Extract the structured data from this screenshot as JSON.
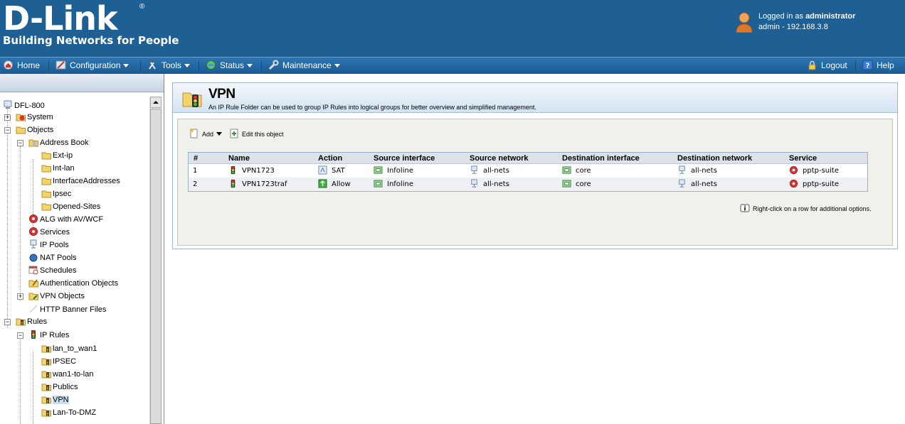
{
  "header": {
    "brand": "D-Link",
    "reg": "®",
    "tagline": "Building Networks for People",
    "logged_in_prefix": "Logged in as",
    "username": "administrator",
    "session": "admin - 192.168.3.8"
  },
  "menu": {
    "home": "Home",
    "configuration": "Configuration",
    "tools": "Tools",
    "status": "Status",
    "maintenance": "Maintenance",
    "logout": "Logout",
    "help": "Help"
  },
  "tree": {
    "root": "DFL-800",
    "system": "System",
    "objects": "Objects",
    "address_book": "Address Book",
    "ext_ip": "Ext-ip",
    "int_lan": "Int-lan",
    "interface_addresses": "InterfaceAddresses",
    "ipsec_obj": "Ipsec",
    "opened_sites": "Opened-Sites",
    "alg": "ALG with AV/WCF",
    "services": "Services",
    "ip_pools": "IP Pools",
    "nat_pools": "NAT Pools",
    "schedules": "Schedules",
    "auth_objects": "Authentication Objects",
    "vpn_objects": "VPN Objects",
    "http_banner": "HTTP Banner Files",
    "rules": "Rules",
    "ip_rules": "IP Rules",
    "lan_to_wan1": "lan_to_wan1",
    "ipsec_rule": "IPSEC",
    "wan1_to_lan": "wan1-to-lan",
    "publics": "Publics",
    "vpn": "VPN",
    "lan_to_dmz": "Lan-To-DMZ"
  },
  "page": {
    "title": "VPN",
    "description": "An IP Rule Folder can be used to group IP Rules into logical groups for better overview and simplified management."
  },
  "toolbar": {
    "add": "Add",
    "edit": "Edit this object"
  },
  "table": {
    "columns": [
      "#",
      "Name",
      "Action",
      "Source interface",
      "Source network",
      "Destination interface",
      "Destination network",
      "Service"
    ],
    "rows": [
      {
        "num": "1",
        "name": "VPN1723",
        "action": "SAT",
        "src_if": "Infoline",
        "src_net": "all-nets",
        "dst_if": "core",
        "dst_net": "all-nets",
        "service": "pptp-suite"
      },
      {
        "num": "2",
        "name": "VPN1723traf",
        "action": "Allow",
        "src_if": "Infoline",
        "src_net": "all-nets",
        "dst_if": "core",
        "dst_net": "all-nets",
        "service": "pptp-suite"
      }
    ]
  },
  "hint": "Right-click on a row for additional options.",
  "colors": {
    "header_bg": "#1e5f94",
    "menu_bg": "#2370ae",
    "selected": "#c9dcf0"
  }
}
